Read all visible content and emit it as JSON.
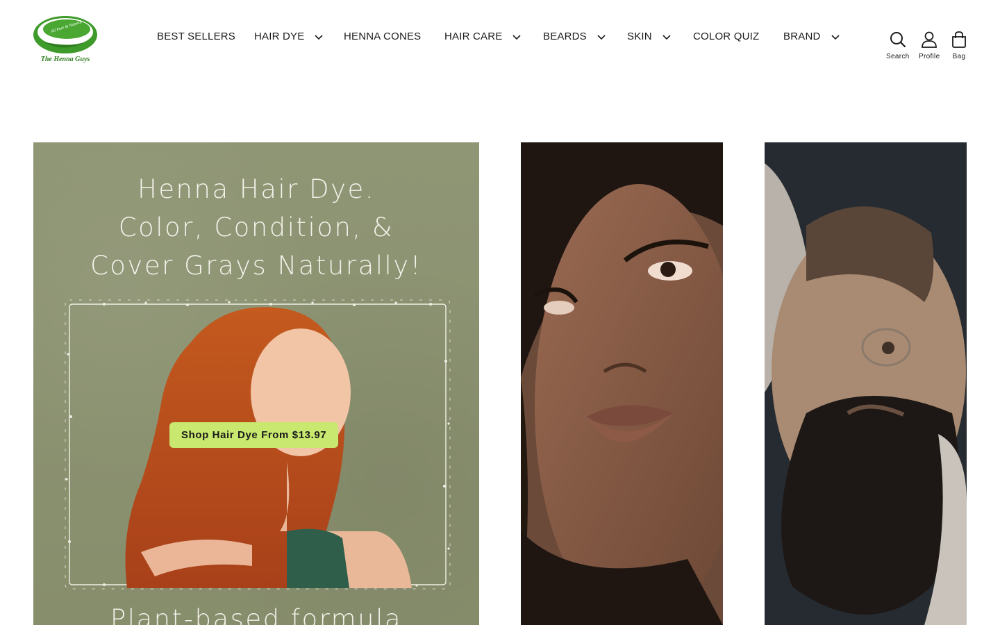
{
  "brand": {
    "name": "The Henna Guys",
    "badge_text": "All Pure & Natural",
    "accent_green": "#3e9a2a",
    "icon": "leaf-logo-icon"
  },
  "nav": {
    "items": [
      {
        "label": "BEST SELLERS",
        "has_dropdown": false
      },
      {
        "label": "HAIR DYE",
        "has_dropdown": true
      },
      {
        "label": "HENNA CONES",
        "has_dropdown": false
      },
      {
        "label": "HAIR CARE",
        "has_dropdown": true
      },
      {
        "label": "BEARDS",
        "has_dropdown": true
      },
      {
        "label": "SKIN",
        "has_dropdown": true
      },
      {
        "label": "COLOR QUIZ",
        "has_dropdown": false
      },
      {
        "label": "BRAND",
        "has_dropdown": true
      }
    ]
  },
  "utilities": {
    "search": {
      "label": "Search",
      "icon": "search-icon"
    },
    "profile": {
      "label": "Profile",
      "icon": "user-icon"
    },
    "bag": {
      "label": "Bag",
      "icon": "bag-icon"
    }
  },
  "hero": {
    "headline_lines": [
      "Henna Hair Dye.",
      "Color, Condition, &",
      "Cover Grays Naturally!"
    ],
    "cta_label": "Shop Hair Dye From $13.97",
    "cta_color": "#c9e86f",
    "subheadline": "Plant-based formula",
    "background_color": "#8b9270"
  },
  "cards": {
    "middle": {
      "image": "woman-portrait-photo"
    },
    "right": {
      "image": "bearded-man-photo"
    }
  }
}
